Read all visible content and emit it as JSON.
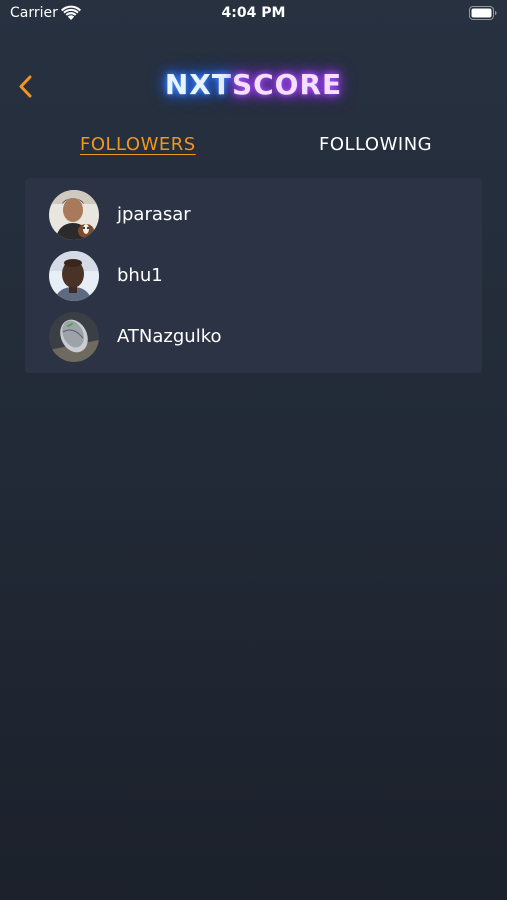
{
  "status_bar": {
    "carrier": "Carrier",
    "time": "4:04 PM"
  },
  "header": {
    "back_icon": "chevron-left-icon",
    "logo_part1": "NXT",
    "logo_part2": "SCORE"
  },
  "tabs": [
    {
      "label": "FOLLOWERS",
      "active": true
    },
    {
      "label": "FOLLOWING",
      "active": false
    }
  ],
  "users": [
    {
      "username": "jparasar"
    },
    {
      "username": "bhu1"
    },
    {
      "username": "ATNazgulko"
    }
  ],
  "colors": {
    "accent": "#f0961f",
    "card_bg": "#2b3345",
    "background": "#232b38"
  }
}
